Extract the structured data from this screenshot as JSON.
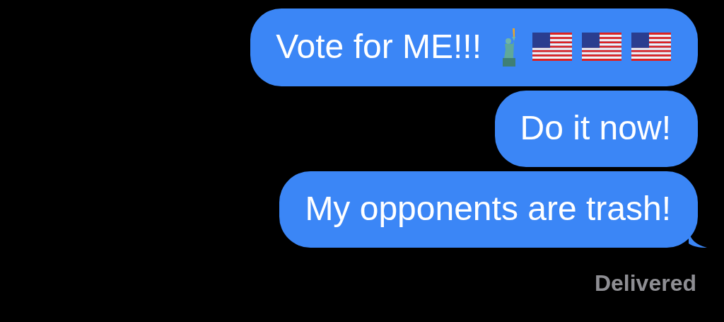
{
  "messages": [
    {
      "text": "Vote for ME!!!",
      "emoji": [
        {
          "kind": "statue"
        },
        {
          "kind": "flag"
        },
        {
          "kind": "flag"
        },
        {
          "kind": "flag"
        }
      ],
      "tail": false
    },
    {
      "text": "Do it now!",
      "tail": false
    },
    {
      "text": "My opponents are trash!",
      "tail": true
    }
  ],
  "status": "Delivered"
}
